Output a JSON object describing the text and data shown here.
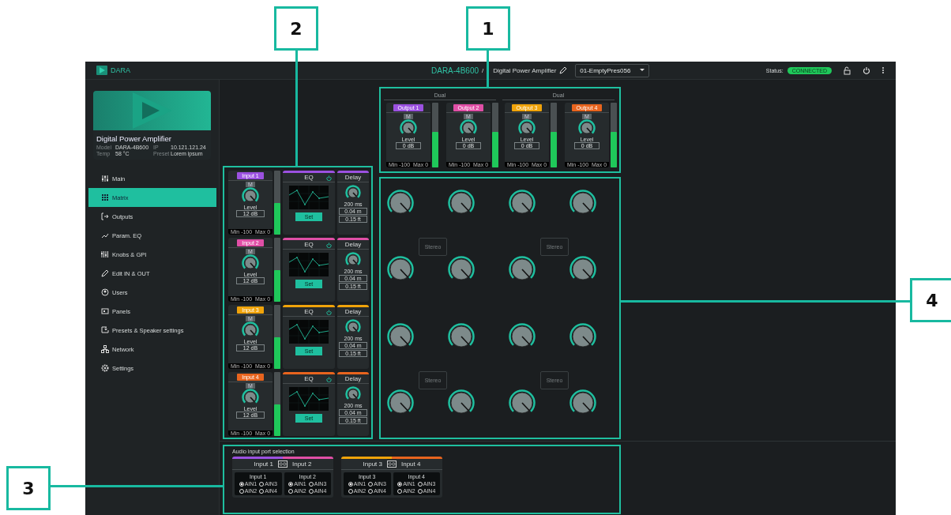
{
  "callouts": [
    {
      "number": "2"
    },
    {
      "number": "1"
    },
    {
      "number": "3"
    },
    {
      "number": "4"
    }
  ],
  "header": {
    "brand": "DARA",
    "device": "DARA-4B600",
    "separator": "/",
    "device_type": "Digital Power Amplifier",
    "preset": "01-EmptyPres056",
    "status_label": "Status:",
    "status": "CONNECTED"
  },
  "device_card": {
    "title": "Digital Power Amplifier",
    "fields": [
      {
        "label": "Model",
        "value": "DARA-4B600"
      },
      {
        "label": "IP",
        "value": "10.121.121.24"
      },
      {
        "label": "Temp",
        "value": "58 °C"
      },
      {
        "label": "Preset",
        "value": "Lorem ipsum"
      }
    ]
  },
  "nav": [
    {
      "label": "Main",
      "selected": false
    },
    {
      "label": "Matrix",
      "selected": true
    },
    {
      "label": "Outputs",
      "selected": false
    },
    {
      "label": "Param. EQ",
      "selected": false
    },
    {
      "label": "Knobs & GPI",
      "selected": false
    },
    {
      "label": "Edit IN & OUT",
      "selected": false
    },
    {
      "label": "Users",
      "selected": false
    },
    {
      "label": "Panels",
      "selected": false
    },
    {
      "label": "Presets  & Speaker settings",
      "selected": false
    },
    {
      "label": "Network",
      "selected": false
    },
    {
      "label": "Settings",
      "selected": false
    }
  ],
  "inputs": [
    {
      "label": "Input 1",
      "color": "#9b51e0",
      "mute": "M",
      "level_label": "Level",
      "gain": "12 dB",
      "range": "Min -100  Max 0",
      "meter": {
        "level": 0.5
      },
      "eq": {
        "title": "EQ",
        "button": "Set"
      },
      "delay": {
        "title": "Delay",
        "time": "200 ms",
        "meters": "0.04 m",
        "feet": "0.15 ft"
      }
    },
    {
      "label": "Input 2",
      "color": "#e04fa6",
      "mute": "M",
      "level_label": "Level",
      "gain": "12 dB",
      "range": "Min -100  Max 0",
      "meter": {
        "level": 0.5
      },
      "eq": {
        "title": "EQ",
        "button": "Set"
      },
      "delay": {
        "title": "Delay",
        "time": "200 ms",
        "meters": "0.04 m",
        "feet": "0.15 ft"
      }
    },
    {
      "label": "Input 3",
      "color": "#f0a30a",
      "mute": "M",
      "level_label": "Level",
      "gain": "12 dB",
      "range": "Min -100  Max 0",
      "meter": {
        "level": 0.5
      },
      "eq": {
        "title": "EQ",
        "button": "Set"
      },
      "delay": {
        "title": "Delay",
        "time": "200 ms",
        "meters": "0.04 m",
        "feet": "0.15 ft"
      }
    },
    {
      "label": "Input 4",
      "color": "#e8641e",
      "mute": "M",
      "level_label": "Level",
      "gain": "12 dB",
      "range": "Min -100  Max 0",
      "meter": {
        "level": 0.5
      },
      "eq": {
        "title": "EQ",
        "button": "Set"
      },
      "delay": {
        "title": "Delay",
        "time": "200 ms",
        "meters": "0.04 m",
        "feet": "0.15 ft"
      }
    }
  ],
  "outputs": [
    {
      "title": "Dual",
      "channels": [
        {
          "label": "Output 1",
          "color": "#9b51e0",
          "mute": "M",
          "level_label": "Level",
          "gain": "0 dB",
          "range": "Min -100  Max 0",
          "meter": {
            "level": 0.55
          }
        },
        {
          "label": "Output 2",
          "color": "#e04fa6",
          "mute": "M",
          "level_label": "Level",
          "gain": "0 dB",
          "range": "Min -100  Max 0",
          "meter": {
            "level": 0.55
          }
        }
      ]
    },
    {
      "title": "Dual",
      "channels": [
        {
          "label": "Output 3",
          "color": "#f0a30a",
          "mute": "M",
          "level_label": "Level",
          "gain": "0 dB",
          "range": "Min -100  Max 0",
          "meter": {
            "level": 0.55
          }
        },
        {
          "label": "Output 4",
          "color": "#e8641e",
          "mute": "M",
          "level_label": "Level",
          "gain": "0 dB",
          "range": "Min -100  Max 0",
          "meter": {
            "level": 0.55
          }
        }
      ]
    }
  ],
  "matrix": {
    "row_pairs": [
      {
        "stereo_buttons": [
          "Stereo",
          "Stereo"
        ]
      },
      {
        "stereo_buttons": [
          "Stereo",
          "Stereo"
        ]
      }
    ]
  },
  "ports": {
    "title": "Audio input port selection",
    "groups": [
      {
        "inputs": [
          {
            "label": "Input 1",
            "color": "#9b51e0"
          },
          {
            "label": "Input 2",
            "color": "#e04fa6"
          }
        ],
        "cards": [
          {
            "title": "Input 1",
            "options": [
              {
                "label": "AIN1",
                "selected": true
              },
              {
                "label": "AIN3",
                "selected": false
              },
              {
                "label": "AIN2",
                "selected": false
              },
              {
                "label": "AIN4",
                "selected": false
              }
            ]
          },
          {
            "title": "Input 2",
            "options": [
              {
                "label": "AIN1",
                "selected": true
              },
              {
                "label": "AIN3",
                "selected": false
              },
              {
                "label": "AIN2",
                "selected": false
              },
              {
                "label": "AIN4",
                "selected": false
              }
            ]
          }
        ]
      },
      {
        "inputs": [
          {
            "label": "Input 3",
            "color": "#f0a30a"
          },
          {
            "label": "Input 4",
            "color": "#e8641e"
          }
        ],
        "cards": [
          {
            "title": "Input 3",
            "options": [
              {
                "label": "AIN1",
                "selected": true
              },
              {
                "label": "AIN3",
                "selected": false
              },
              {
                "label": "AIN2",
                "selected": false
              },
              {
                "label": "AIN4",
                "selected": false
              }
            ]
          },
          {
            "title": "Input 4",
            "options": [
              {
                "label": "AIN1",
                "selected": true
              },
              {
                "label": "AIN3",
                "selected": false
              },
              {
                "label": "AIN2",
                "selected": false
              },
              {
                "label": "AIN4",
                "selected": false
              }
            ]
          }
        ]
      }
    ]
  }
}
